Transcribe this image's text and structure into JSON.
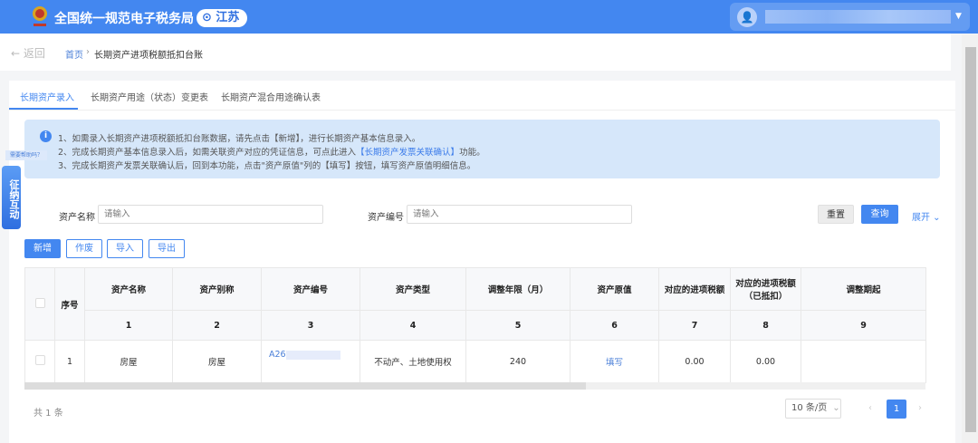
{
  "header": {
    "title": "全国统一规范电子税务局",
    "province": "江苏",
    "user_caret": "▼"
  },
  "breadcrumb": {
    "back": "← 返回",
    "home": "首页",
    "separator": "›",
    "current": "长期资产进项税额抵扣台账"
  },
  "tabs": [
    {
      "label": "长期资产录入",
      "active": true
    },
    {
      "label": "长期资产用途（状态）变更表"
    },
    {
      "label": "长期资产混合用途确认表"
    }
  ],
  "info": {
    "icon": "i",
    "line1": "1、如需录入长期资产进项税额抵扣台账数据，请先点击【新增】，进行长期资产基本信息录入。",
    "line2_pre": "2、完成长期资产基本信息录入后，如需关联资产对应的凭证信息，可点此进入",
    "line2_link": "【长期资产发票关联确认】",
    "line2_post": "功能。",
    "line3": "3、完成长期资产发票关联确认后，回到本功能，点击\"资产原值\"列的【填写】按钮，填写资产原值明细信息。"
  },
  "float_widget": {
    "label": "征纳互动",
    "tip": "需要帮助吗？"
  },
  "search": {
    "name_label": "资产名称",
    "name_placeholder": "请输入",
    "code_label": "资产编号",
    "code_placeholder": "请输入",
    "reset": "重置",
    "query": "查询",
    "expand": "展开 ⌄"
  },
  "actions": {
    "add": "新增",
    "void": "作废",
    "import": "导入",
    "export": "导出"
  },
  "table": {
    "headers": [
      "序号",
      "资产名称",
      "资产别称",
      "资产编号",
      "资产类型",
      "调整年限（月）",
      "资产原值",
      "对应的进项税额",
      "对应的进项税额（已抵扣）",
      "调整期起"
    ],
    "col_numbers": [
      "1",
      "2",
      "3",
      "4",
      "5",
      "6",
      "7",
      "8",
      "9"
    ],
    "rows": [
      {
        "index": "1",
        "name": "房屋",
        "alias": "房屋",
        "code": "A26",
        "type": "不动产、土地使用权",
        "years": "240",
        "value": "填写",
        "tax": "0.00",
        "tax_deducted": "0.00",
        "start": ""
      }
    ]
  },
  "footer": {
    "total": "共 1 条",
    "page_size": "10 条/页",
    "page": "1",
    "prev": "‹",
    "next": "›"
  },
  "colors": {
    "primary": "#4387f0",
    "info_bg": "#d6e7fa"
  }
}
